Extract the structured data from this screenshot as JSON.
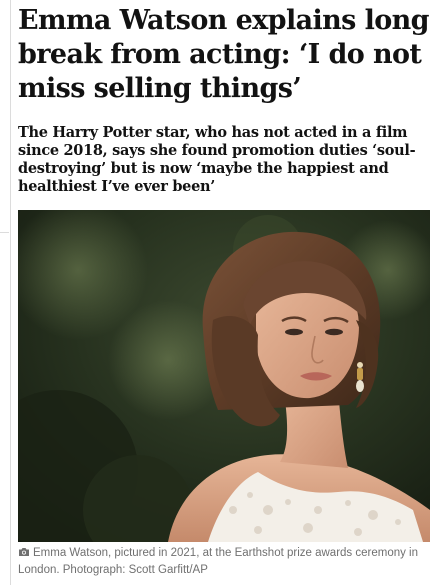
{
  "article": {
    "headline": "Emma Watson explains long break from acting: ‘I do not miss selling things’",
    "standfirst": "The Harry Potter star, who has not acted in a film since 2018, says she found promotion duties ‘soul-destroying’ but is now ‘maybe the happiest and healthiest I’ve ever been’",
    "caption": "Emma Watson, pictured in 2021, at the Earthshot prize awards ceremony in London. Photograph: Scott Garfitt/AP"
  },
  "icons": {
    "caption_icon": "camera-icon"
  },
  "colors": {
    "headline": "#121212",
    "caption": "#707070"
  }
}
